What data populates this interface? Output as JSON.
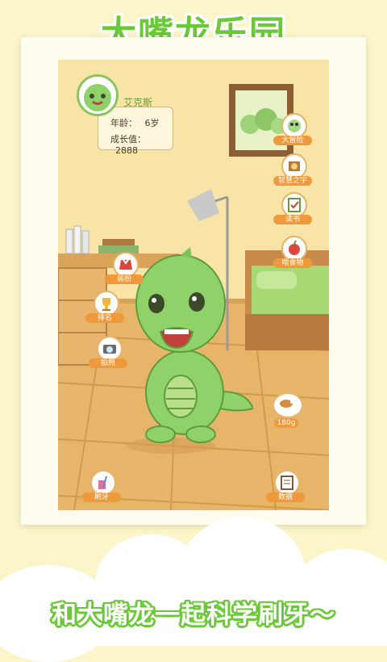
{
  "banner": {
    "title": "大嘴龙乐园"
  },
  "tagline": "和大嘴龙一起科学刷牙～",
  "profile": {
    "name": "艾克斯",
    "age_label": "年龄：",
    "age_value": "6岁",
    "growth_label": "成长值：",
    "growth_value": "2888"
  },
  "buttons": {
    "left": [
      {
        "label": "装扮",
        "icon": "wardrobe-icon"
      },
      {
        "label": "排名",
        "icon": "trophy-icon"
      },
      {
        "label": "拍照",
        "icon": "camera-icon"
      },
      {
        "label": "刷牙",
        "icon": "toothbrush-cup-icon"
      }
    ],
    "right": [
      {
        "label": "大冒险",
        "icon": "adventure-icon"
      },
      {
        "label": "智慧之宇",
        "icon": "wisdom-icon"
      },
      {
        "label": "读书",
        "icon": "checklist-icon"
      },
      {
        "label": "喂食物",
        "icon": "food-icon"
      },
      {
        "label": "数据",
        "icon": "data-icon"
      }
    ]
  },
  "weight": "180g",
  "colors": {
    "brand_green": "#6bc838",
    "button_orange": "#ee9a3c",
    "dino_green": "#8fd26a"
  }
}
